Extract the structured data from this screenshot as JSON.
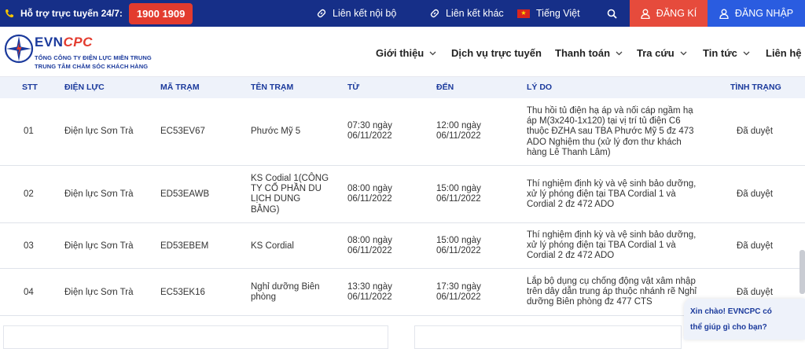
{
  "topbar": {
    "support_label": "Hỗ trợ trực tuyến 24/7:",
    "hotline": "1900 1909",
    "link_internal": "Liên kết nội bộ",
    "link_other": "Liên kết khác",
    "language": "Tiếng Việt",
    "register": "ĐĂNG KÍ",
    "login": "ĐĂNG NHẬP"
  },
  "header": {
    "brand_evn": "EVN",
    "brand_cpc": "CPC",
    "subtitle1": "TỔNG CÔNG TY ĐIỆN LỰC MIỀN TRUNG",
    "subtitle2": "TRUNG TÂM CHĂM SÓC KHÁCH HÀNG",
    "nav": [
      {
        "label": "Giới thiệu"
      },
      {
        "label": "Dịch vụ trực tuyến"
      },
      {
        "label": "Thanh toán"
      },
      {
        "label": "Tra cứu"
      },
      {
        "label": "Tin tức"
      },
      {
        "label": "Liên hệ"
      }
    ]
  },
  "table": {
    "headers": [
      "STT",
      "ĐIỆN LỰC",
      "MÃ TRẠM",
      "TÊN TRẠM",
      "TỪ",
      "ĐẾN",
      "LÝ DO",
      "TÌNH TRẠNG"
    ],
    "rows": [
      {
        "stt": "01",
        "dien_luc": "Điện lực Sơn Trà",
        "ma_tram": "EC53EV67",
        "ten_tram": "Phước Mỹ 5",
        "tu_time": "07:30 ngày",
        "tu_date": "06/11/2022",
        "den_time": "12:00 ngày",
        "den_date": "06/11/2022",
        "ly_do": [
          "Thu hồi tủ điện hạ áp và nối cáp ngầm hạ",
          "áp M(3x240-1x120) tại vị trí tủ điện C6",
          "thuộc ĐZHA sau TBA Phước Mỹ 5 đz 473",
          "ADO Nghiệm thu (xử lý đơn thư khách",
          "hàng Lê Thanh Lâm)"
        ],
        "tinh_trang": "Đã duyệt"
      },
      {
        "stt": "02",
        "dien_luc": "Điện lực Sơn Trà",
        "ma_tram": "ED53EAWB",
        "ten_tram": [
          "KS Codial 1(CÔNG",
          "TY CỔ PHẦN DU",
          "LỊCH DUNG",
          "BẰNG)"
        ],
        "tu_time": "08:00 ngày",
        "tu_date": "06/11/2022",
        "den_time": "15:00 ngày",
        "den_date": "06/11/2022",
        "ly_do": [
          "Thí nghiệm định kỳ và vệ sinh bảo dưỡng,",
          "xử lý phóng điện tại TBA Cordial 1 và",
          "Cordial 2 đz 472 ADO"
        ],
        "tinh_trang": "Đã duyệt"
      },
      {
        "stt": "03",
        "dien_luc": "Điện lực Sơn Trà",
        "ma_tram": "ED53EBEM",
        "ten_tram": "KS Cordial",
        "tu_time": "08:00 ngày",
        "tu_date": "06/11/2022",
        "den_time": "15:00 ngày",
        "den_date": "06/11/2022",
        "ly_do": [
          "Thí nghiệm định kỳ và vệ sinh bảo dưỡng,",
          "xử lý phóng điện tại TBA Cordial 1 và",
          "Cordial 2 đz 472 ADO"
        ],
        "tinh_trang": "Đã duyệt"
      },
      {
        "stt": "04",
        "dien_luc": "Điện lực Sơn Trà",
        "ma_tram": "EC53EK16",
        "ten_tram": [
          "Nghỉ dưỡng Biên",
          "phòng"
        ],
        "tu_time": "13:30 ngày",
        "tu_date": "06/11/2022",
        "den_time": "17:30 ngày",
        "den_date": "06/11/2022",
        "ly_do": [
          "Lắp bộ dụng cụ chống động vật xâm nhập",
          "trên dây dẫn trung áp thuộc nhánh rẽ Nghỉ",
          "dưỡng Biên phòng đz 477 CTS"
        ],
        "tinh_trang": "Đã duyệt"
      }
    ]
  },
  "chat": {
    "line1": "Xin chào! EVNCPC có",
    "line2": "thể giúp gì cho bạn?"
  }
}
